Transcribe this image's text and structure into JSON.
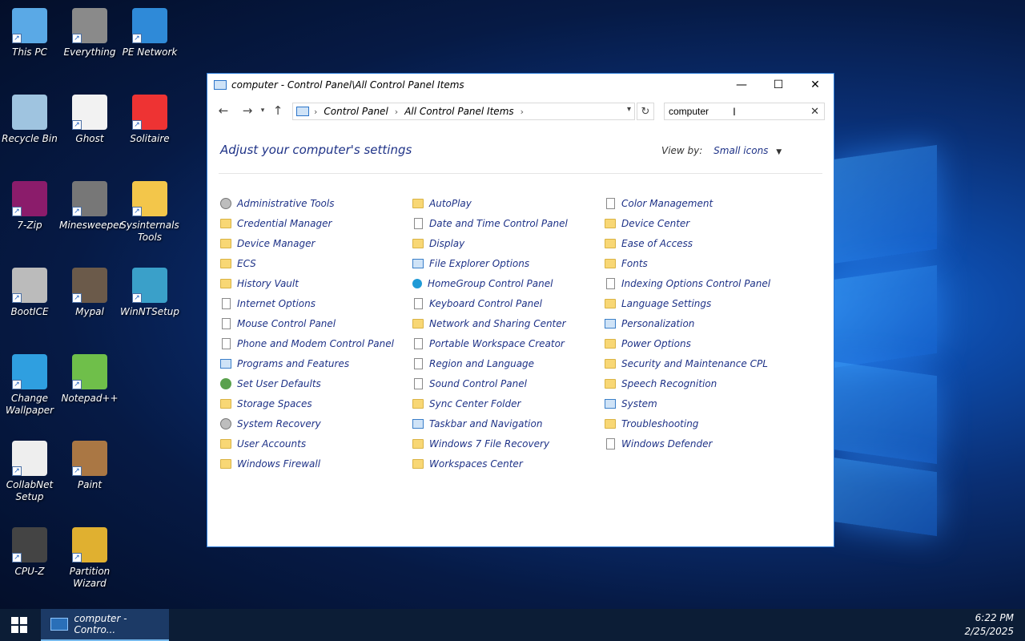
{
  "desktop": {
    "icons": [
      {
        "label": "This PC"
      },
      {
        "label": "Everything"
      },
      {
        "label": "PE Network"
      },
      {
        "label": "Recycle Bin"
      },
      {
        "label": "Ghost"
      },
      {
        "label": "Solitaire"
      },
      {
        "label": "7-Zip"
      },
      {
        "label": "Minesweeper"
      },
      {
        "label": "Sysinternals Tools"
      },
      {
        "label": "BootICE"
      },
      {
        "label": "Mypal"
      },
      {
        "label": "WinNTSetup"
      },
      {
        "label": "Change Wallpaper"
      },
      {
        "label": "Notepad++"
      },
      {
        "label": "CollabNet Setup"
      },
      {
        "label": "Paint"
      },
      {
        "label": "CPU-Z"
      },
      {
        "label": "Partition Wizard"
      }
    ]
  },
  "window": {
    "title": "computer - Control Panel\\All Control Panel Items",
    "breadcrumb": [
      "Control Panel",
      "All Control Panel Items"
    ],
    "search_value": "computer",
    "heading": "Adjust your computer's settings",
    "view_by_label": "View by:",
    "view_by_value": "Small icons",
    "columns": [
      [
        {
          "label": "Administrative Tools",
          "icon": "gear"
        },
        {
          "label": "Credential Manager",
          "icon": "folder"
        },
        {
          "label": "Device Manager",
          "icon": "folder"
        },
        {
          "label": "ECS",
          "icon": "folder"
        },
        {
          "label": "History Vault",
          "icon": "folder"
        },
        {
          "label": "Internet Options",
          "icon": "doc"
        },
        {
          "label": "Mouse Control Panel",
          "icon": "doc"
        },
        {
          "label": "Phone and Modem Control Panel",
          "icon": "doc"
        },
        {
          "label": "Programs and Features",
          "icon": "app"
        },
        {
          "label": "Set User Defaults",
          "icon": "shield"
        },
        {
          "label": "Storage Spaces",
          "icon": "folder"
        },
        {
          "label": "System Recovery",
          "icon": "gear"
        },
        {
          "label": "User Accounts",
          "icon": "folder"
        },
        {
          "label": "Windows Firewall",
          "icon": "folder"
        }
      ],
      [
        {
          "label": "AutoPlay",
          "icon": "folder"
        },
        {
          "label": "Date and Time Control Panel",
          "icon": "doc"
        },
        {
          "label": "Display",
          "icon": "folder"
        },
        {
          "label": "File Explorer Options",
          "icon": "app"
        },
        {
          "label": "HomeGroup Control Panel",
          "icon": "net"
        },
        {
          "label": "Keyboard Control Panel",
          "icon": "doc"
        },
        {
          "label": "Network and Sharing Center",
          "icon": "folder"
        },
        {
          "label": "Portable Workspace Creator",
          "icon": "doc"
        },
        {
          "label": "Region and Language",
          "icon": "doc"
        },
        {
          "label": "Sound Control Panel",
          "icon": "doc"
        },
        {
          "label": "Sync Center Folder",
          "icon": "folder"
        },
        {
          "label": "Taskbar and Navigation",
          "icon": "app"
        },
        {
          "label": "Windows 7 File Recovery",
          "icon": "folder"
        },
        {
          "label": "Workspaces Center",
          "icon": "folder"
        }
      ],
      [
        {
          "label": "Color Management",
          "icon": "doc"
        },
        {
          "label": "Device Center",
          "icon": "folder"
        },
        {
          "label": "Ease of Access",
          "icon": "folder"
        },
        {
          "label": "Fonts",
          "icon": "folder"
        },
        {
          "label": "Indexing Options Control Panel",
          "icon": "doc"
        },
        {
          "label": "Language Settings",
          "icon": "folder"
        },
        {
          "label": "Personalization",
          "icon": "app"
        },
        {
          "label": "Power Options",
          "icon": "folder"
        },
        {
          "label": "Security and Maintenance CPL",
          "icon": "folder"
        },
        {
          "label": "Speech Recognition",
          "icon": "folder"
        },
        {
          "label": "System",
          "icon": "app"
        },
        {
          "label": "Troubleshooting",
          "icon": "folder"
        },
        {
          "label": "Windows Defender",
          "icon": "doc"
        }
      ]
    ]
  },
  "taskbar": {
    "task_label": "computer - Contro...",
    "time": "6:22 PM",
    "date": "2/25/2025"
  }
}
